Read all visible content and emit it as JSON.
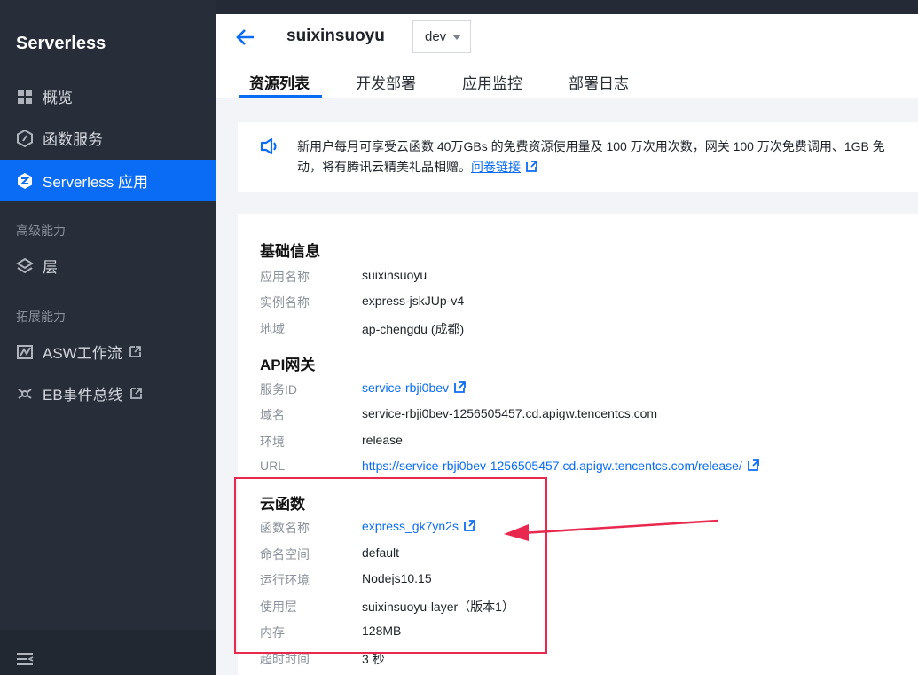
{
  "sidebar": {
    "brand": "Serverless",
    "items": [
      {
        "label": "概览",
        "icon": "grid-icon"
      },
      {
        "label": "函数服务",
        "icon": "function-icon"
      },
      {
        "label": "Serverless 应用",
        "icon": "serverless-app-icon"
      }
    ],
    "groups": [
      {
        "label": "高级能力",
        "items": [
          {
            "label": "层",
            "icon": "layers-icon"
          }
        ]
      },
      {
        "label": "拓展能力",
        "items": [
          {
            "label": "ASW工作流",
            "icon": "workflow-icon"
          },
          {
            "label": "EB事件总线",
            "icon": "event-bus-icon"
          }
        ]
      }
    ]
  },
  "header": {
    "title": "suixinsuoyu",
    "env": "dev",
    "tabs": [
      "资源列表",
      "开发部署",
      "应用监控",
      "部署日志"
    ]
  },
  "notice": {
    "line1": "新用户每月可享受云函数 40万GBs 的免费资源使用量及 100 万次用次数，网关 100 万次免费调用、1GB 免",
    "line2": "动，将有腾讯云精美礼品相赠。",
    "link": "问卷链接"
  },
  "basic": {
    "title": "基础信息",
    "rows": [
      {
        "label": "应用名称",
        "value": "suixinsuoyu"
      },
      {
        "label": "实例名称",
        "value": "express-jskJUp-v4"
      },
      {
        "label": "地域",
        "value": "ap-chengdu (成都)"
      }
    ]
  },
  "api": {
    "title": "API网关",
    "rows": [
      {
        "label": "服务ID",
        "value": "service-rbji0bev"
      },
      {
        "label": "域名",
        "value": "service-rbji0bev-1256505457.cd.apigw.tencentcs.com"
      },
      {
        "label": "环境",
        "value": "release"
      },
      {
        "label": "URL",
        "value": "https://service-rbji0bev-1256505457.cd.apigw.tencentcs.com/release/"
      }
    ]
  },
  "scf": {
    "title": "云函数",
    "rows": [
      {
        "label": "函数名称",
        "value": "express_gk7yn2s"
      },
      {
        "label": "命名空间",
        "value": "default"
      },
      {
        "label": "运行环境",
        "value": "Nodejs10.15"
      },
      {
        "label": "使用层",
        "value": "suixinsuoyu-layer（版本1）"
      },
      {
        "label": "内存",
        "value": "128MB"
      },
      {
        "label": "超时时间",
        "value": "3 秒"
      }
    ]
  },
  "colors": {
    "accent": "#0a6cf5",
    "sidebar_bg": "#272e3a",
    "annotation": "#e8284e"
  }
}
